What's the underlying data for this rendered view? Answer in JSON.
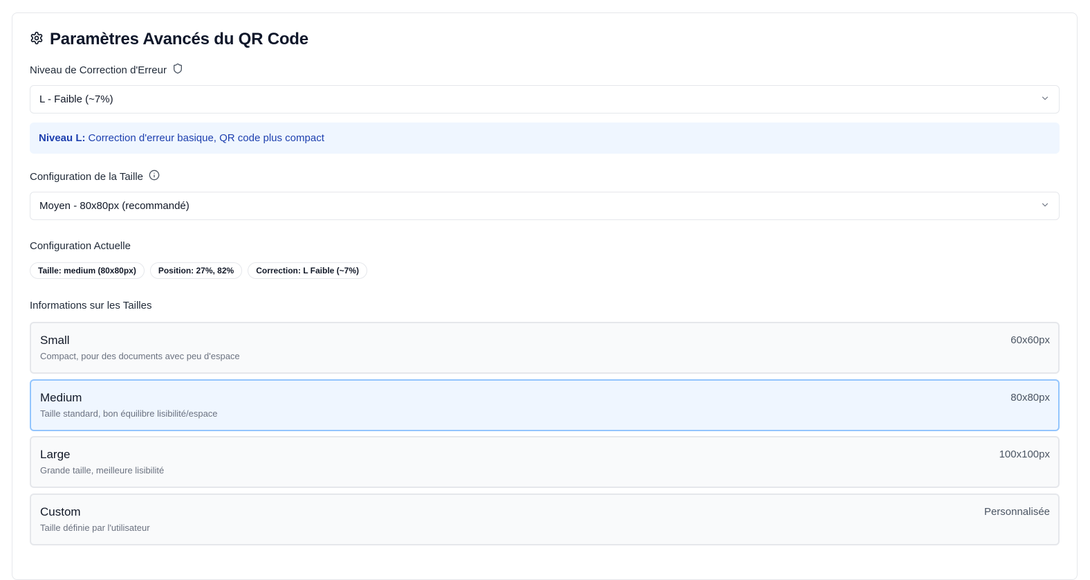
{
  "header": {
    "title": "Paramètres Avancés du QR Code",
    "icon": "gear-icon"
  },
  "error_correction": {
    "label": "Niveau de Correction d'Erreur",
    "selected": "L - Faible (~7%)",
    "info_title": "Niveau L:",
    "info_text": "Correction d'erreur basique, QR code plus compact"
  },
  "size_config": {
    "label": "Configuration de la Taille",
    "selected": "Moyen - 80x80px (recommandé)"
  },
  "current_config": {
    "label": "Configuration Actuelle",
    "badges": [
      "Taille: medium (80x80px)",
      "Position: 27%, 82%",
      "Correction: L Faible (~7%)"
    ]
  },
  "sizes_info": {
    "label": "Informations sur les Tailles",
    "items": [
      {
        "name": "Small",
        "desc": "Compact, pour des documents avec peu d'espace",
        "dim": "60x60px",
        "selected": false
      },
      {
        "name": "Medium",
        "desc": "Taille standard, bon équilibre lisibilité/espace",
        "dim": "80x80px",
        "selected": true
      },
      {
        "name": "Large",
        "desc": "Grande taille, meilleure lisibilité",
        "dim": "100x100px",
        "selected": false
      },
      {
        "name": "Custom",
        "desc": "Taille définie par l'utilisateur",
        "dim": "Personnalisée",
        "selected": false
      }
    ]
  },
  "colors": {
    "accent": "#1e40af",
    "info_bg": "#eff6ff",
    "selected_border": "#93c5fd"
  }
}
